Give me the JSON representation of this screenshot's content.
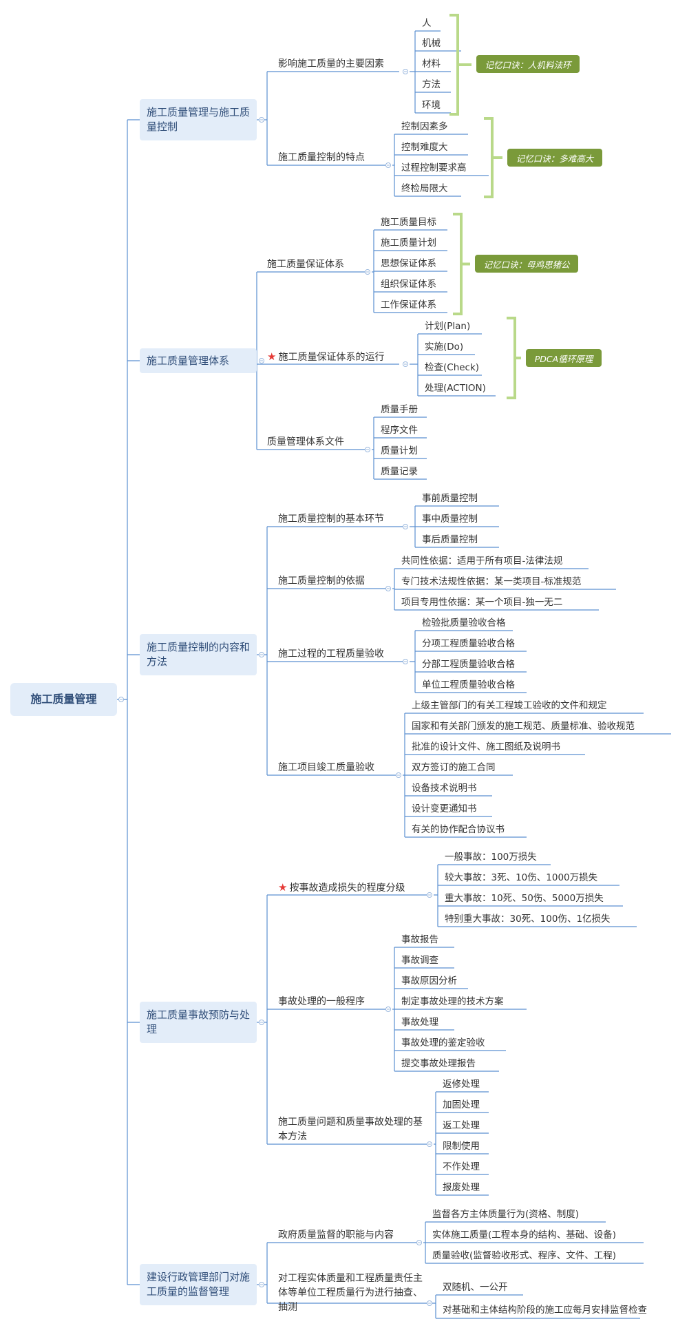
{
  "root": "施工质量管理",
  "sections": [
    {
      "title": "施工质量管理与施工质量控制",
      "children": [
        {
          "label": "影响施工质量的主要因素",
          "items": [
            "人",
            "机械",
            "材料",
            "方法",
            "环境"
          ],
          "mnemonic": "记忆口诀：人机料法环"
        },
        {
          "label": "施工质量控制的特点",
          "items": [
            "控制因素多",
            "控制难度大",
            "过程控制要求高",
            "终检局限大"
          ],
          "mnemonic": "记忆口诀：多难高大"
        }
      ]
    },
    {
      "title": "施工质量管理体系",
      "children": [
        {
          "label": "施工质量保证体系",
          "items": [
            "施工质量目标",
            "施工质量计划",
            "思想保证体系",
            "组织保证体系",
            "工作保证体系"
          ],
          "mnemonic": "记忆口诀：母鸡思猪公"
        },
        {
          "label": "施工质量保证体系的运行",
          "starred": true,
          "items": [
            "计划(Plan)",
            "实施(Do)",
            "检查(Check)",
            "处理(ACTION)"
          ],
          "mnemonic": "PDCA循环原理"
        },
        {
          "label": "质量管理体系文件",
          "items": [
            "质量手册",
            "程序文件",
            "质量计划",
            "质量记录"
          ]
        }
      ]
    },
    {
      "title": "施工质量控制的内容和方法",
      "children": [
        {
          "label": "施工质量控制的基本环节",
          "items": [
            "事前质量控制",
            "事中质量控制",
            "事后质量控制"
          ]
        },
        {
          "label": "施工质量控制的依据",
          "items": [
            "共同性依据：适用于所有项目-法律法规",
            "专门技术法规性依据：某一类项目-标准规范",
            "项目专用性依据：某一个项目-独一无二"
          ]
        },
        {
          "label": "施工过程的工程质量验收",
          "items": [
            "检验批质量验收合格",
            "分项工程质量验收合格",
            "分部工程质量验收合格",
            "单位工程质量验收合格"
          ]
        },
        {
          "label": "施工项目竣工质量验收",
          "items": [
            "上级主管部门的有关工程竣工验收的文件和规定",
            "国家和有关部门颁发的施工规范、质量标准、验收规范",
            "批准的设计文件、施工图纸及说明书",
            "双方签订的施工合同",
            "设备技术说明书",
            "设计变更通知书",
            "有关的协作配合协议书"
          ]
        }
      ]
    },
    {
      "title": "施工质量事故预防与处理",
      "children": [
        {
          "label": "按事故造成损失的程度分级",
          "starred": true,
          "items": [
            "一般事故：100万损失",
            "较大事故：3死、10伤、1000万损失",
            "重大事故：10死、50伤、5000万损失",
            "特别重大事故：30死、100伤、1亿损失"
          ]
        },
        {
          "label": "事故处理的一般程序",
          "items": [
            "事故报告",
            "事故调查",
            "事故原因分析",
            "制定事故处理的技术方案",
            "事故处理",
            "事故处理的鉴定验收",
            "提交事故处理报告"
          ]
        },
        {
          "label": "施工质量问题和质量事故处理的基本方法",
          "items": [
            "返修处理",
            "加固处理",
            "返工处理",
            "限制使用",
            "不作处理",
            "报废处理"
          ]
        }
      ]
    },
    {
      "title": "建设行政管理部门对施工质量的监督管理",
      "children": [
        {
          "label": "政府质量监督的职能与内容",
          "items": [
            "监督各方主体质量行为(资格、制度)",
            "实体施工质量(工程本身的结构、基础、设备)",
            "质量验收(监督验收形式、程序、文件、工程)"
          ]
        },
        {
          "label": "对工程实体质量和工程质量责任主体等单位工程质量行为进行抽查、抽测",
          "items": [
            "双随机、一公开",
            "对基础和主体结构阶段的施工应每月安排监督检查"
          ]
        }
      ]
    }
  ],
  "colors": {
    "line": "#5b8fd0",
    "bracket": "#b9d989",
    "tag": "#7a9a3a",
    "node_bg": "#e3edf9",
    "star": "#e53935"
  }
}
